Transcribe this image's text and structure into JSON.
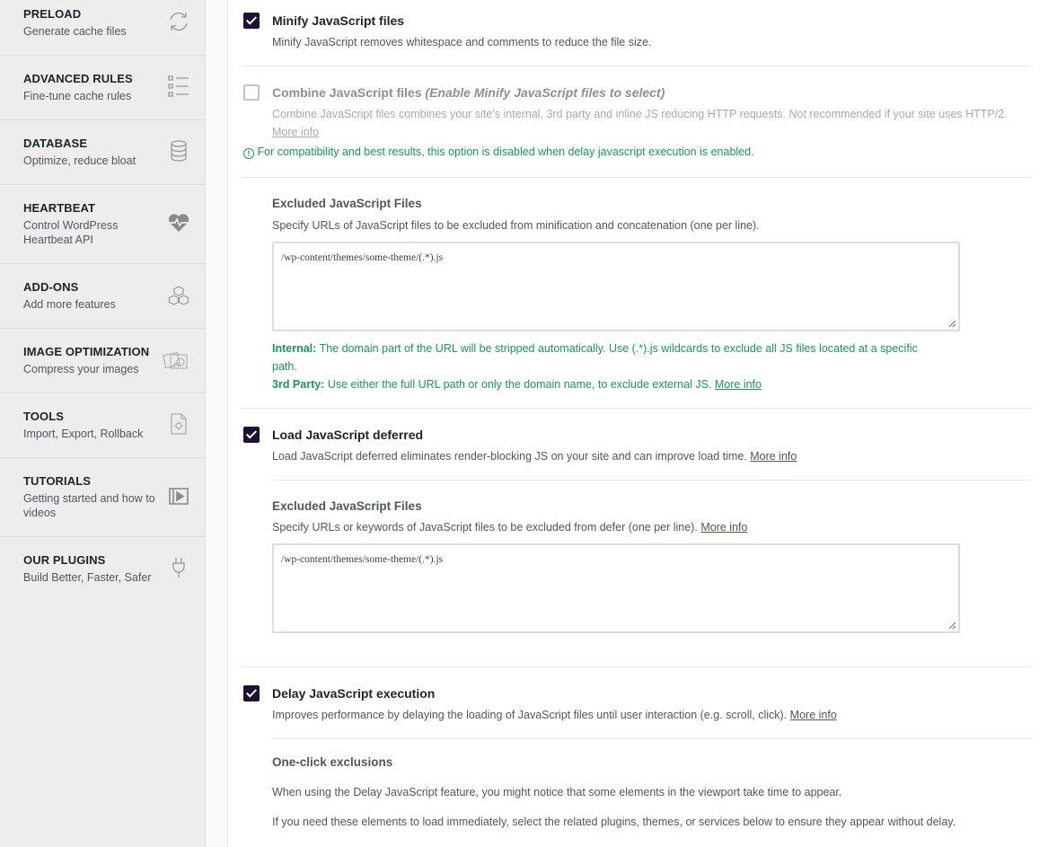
{
  "sidebar": {
    "items": [
      {
        "title": "PRELOAD",
        "subtitle": "Generate cache files",
        "icon": "refresh-icon"
      },
      {
        "title": "ADVANCED RULES",
        "subtitle": "Fine-tune cache rules",
        "icon": "list-icon"
      },
      {
        "title": "DATABASE",
        "subtitle": "Optimize, reduce bloat",
        "icon": "database-icon"
      },
      {
        "title": "HEARTBEAT",
        "subtitle": "Control WordPress Heartbeat API",
        "icon": "heartbeat-icon"
      },
      {
        "title": "ADD-ONS",
        "subtitle": "Add more features",
        "icon": "cubes-icon"
      },
      {
        "title": "IMAGE OPTIMIZATION",
        "subtitle": "Compress your images",
        "icon": "image-icon"
      },
      {
        "title": "TOOLS",
        "subtitle": "Import, Export, Rollback",
        "icon": "tools-icon"
      },
      {
        "title": "TUTORIALS",
        "subtitle": "Getting started and how to videos",
        "icon": "video-icon"
      },
      {
        "title": "OUR PLUGINS",
        "subtitle": "Build Better, Faster, Safer",
        "icon": "plug-icon"
      }
    ]
  },
  "options": {
    "minify": {
      "checked": true,
      "label": "Minify JavaScript files",
      "description": "Minify JavaScript removes whitespace and comments to reduce the file size."
    },
    "combine": {
      "checked": false,
      "label": "Combine JavaScript files",
      "label_note": "(Enable Minify JavaScript files to select)",
      "description": "Combine JavaScript files combines your site’s internal, 3rd party and inline JS reducing HTTP requests. Not recommended if your site uses HTTP/2.",
      "more_info": "More info",
      "notice": "For compatibility and best results, this option is disabled when delay javascript execution is enabled."
    },
    "excluded_minify": {
      "title": "Excluded JavaScript Files",
      "description": "Specify URLs of JavaScript files to be excluded from minification and concatenation (one per line).",
      "value": "/wp-content/themes/some-theme/(.*).js",
      "internal_label": "Internal:",
      "internal_text": "The domain part of the URL will be stripped automatically. Use (.*).js wildcards to exclude all JS files located at a specific path.",
      "third_label": "3rd Party:",
      "third_text": "Use either the full URL path or only the domain name, to exclude external JS.",
      "more_info": "More info"
    },
    "defer": {
      "checked": true,
      "label": "Load JavaScript deferred",
      "description": "Load JavaScript deferred eliminates render-blocking JS on your site and can improve load time.",
      "more_info": "More info"
    },
    "excluded_defer": {
      "title": "Excluded JavaScript Files",
      "description": "Specify URLs or keywords of JavaScript files to be excluded from defer (one per line).",
      "more_info": "More info",
      "value": "/wp-content/themes/some-theme/(.*).js"
    },
    "delay": {
      "checked": true,
      "label": "Delay JavaScript execution",
      "description": "Improves performance by delaying the loading of JavaScript files until user interaction (e.g. scroll, click).",
      "more_info": "More info"
    },
    "one_click": {
      "title": "One-click exclusions",
      "paragraph1": "When using the Delay JavaScript feature, you might notice that some elements in the viewport take time to appear.",
      "paragraph2": "If you need these elements to load immediately, select the related plugins, themes, or services below to ensure they appear without delay."
    }
  },
  "colors": {
    "checkbox_on": "#1f1135",
    "accent_green": "#149b57",
    "sidebar_bg": "#ededed"
  }
}
